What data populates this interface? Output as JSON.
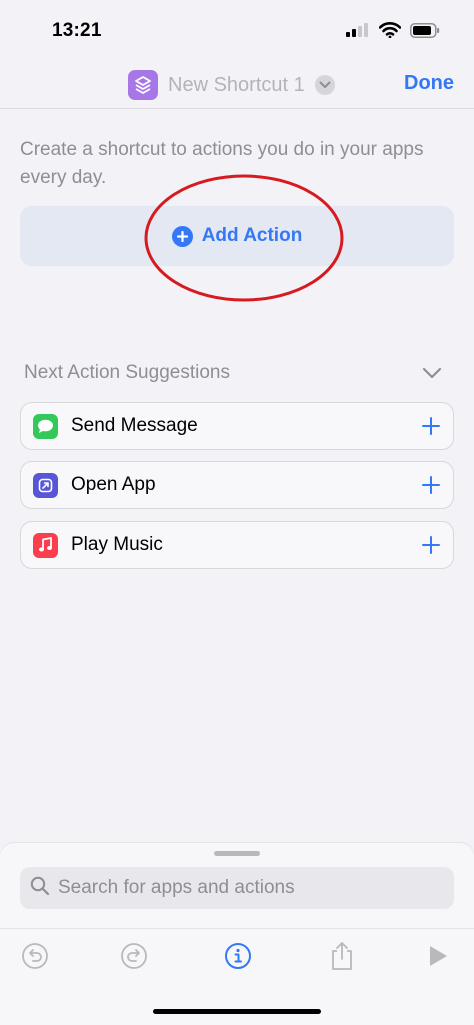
{
  "status_bar": {
    "time": "13:21"
  },
  "nav": {
    "title": "New Shortcut 1",
    "done_label": "Done"
  },
  "intro_text": "Create a shortcut to actions you do in your apps every day.",
  "add_action": {
    "label": "Add Action"
  },
  "suggestions": {
    "title": "Next Action Suggestions",
    "items": [
      {
        "label": "Send Message",
        "icon": "messages-icon",
        "color": "#34c759"
      },
      {
        "label": "Open App",
        "icon": "open-app-icon",
        "color": "#5856d6"
      },
      {
        "label": "Play Music",
        "icon": "music-icon",
        "color": "#fa3e4e"
      }
    ]
  },
  "search": {
    "placeholder": "Search for apps and actions"
  },
  "colors": {
    "accent": "#3478f6",
    "annotation_ring": "#d71920"
  }
}
